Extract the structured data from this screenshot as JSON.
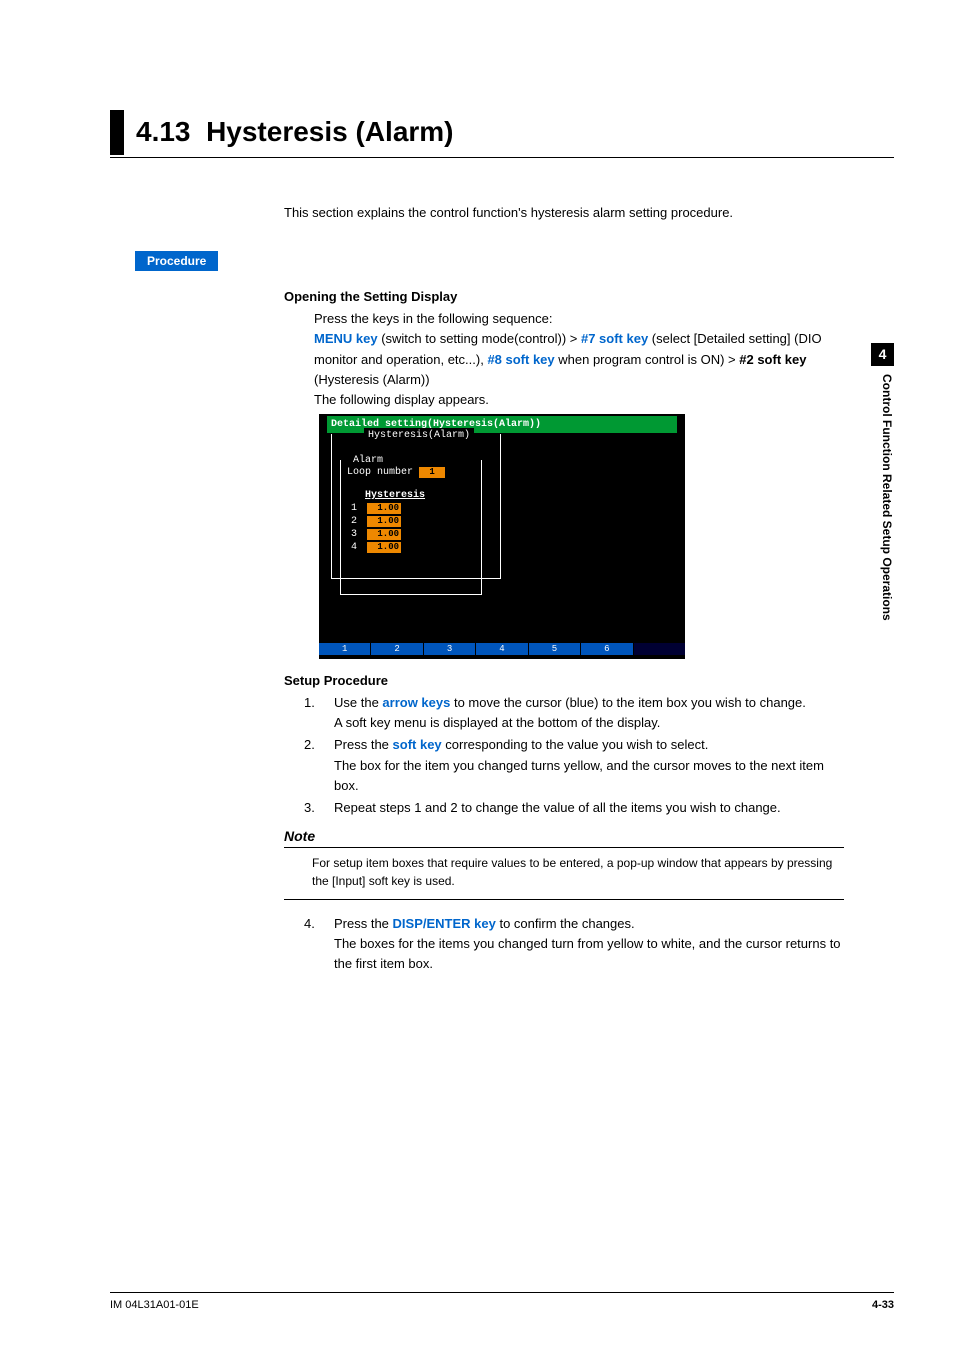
{
  "chapter_tab": "4",
  "side_text": "Control Function Related Setup Operations",
  "section_number": "4.13",
  "section_title": "Hysteresis (Alarm)",
  "intro": "This section explains the control function's hysteresis alarm setting procedure.",
  "procedure_label": "Procedure",
  "opening_head": "Opening the Setting Display",
  "opening_intro": "Press the keys in the following sequence:",
  "keys": {
    "menu": "MENU key",
    "menu_after": " (switch to setting mode(control)) > ",
    "sk7": "#7 soft key",
    "sk7_after": " (select [Detailed setting] (DIO monitor and operation, etc...), ",
    "sk8": "#8 soft key",
    "sk8_after": " when program control is ON) > ",
    "sk2": "#2 soft key",
    "sk2_after": " (Hysteresis (Alarm))"
  },
  "following_display": "The following display appears.",
  "figure": {
    "title": "Detailed setting(Hysteresis(Alarm))",
    "legend": "Hysteresis(Alarm)",
    "alarm_label": "Alarm",
    "loop_label": "Loop number",
    "loop_value": "1",
    "hyst_header": "Hysteresis",
    "rows": [
      {
        "n": "1",
        "v": "1.00"
      },
      {
        "n": "2",
        "v": "1.00"
      },
      {
        "n": "3",
        "v": "1.00"
      },
      {
        "n": "4",
        "v": "1.00"
      }
    ],
    "softkeys": [
      "1",
      "2",
      "3",
      "4",
      "5",
      "6",
      ""
    ]
  },
  "setup_head": "Setup Procedure",
  "steps": [
    {
      "n": "1.",
      "pre": "Use the ",
      "key": "arrow keys",
      "post": " to move the cursor (blue) to the item box you wish to change.",
      "extra": "A soft key menu is displayed at the bottom of the display."
    },
    {
      "n": "2.",
      "pre": "Press the ",
      "key": "soft key",
      "post": " corresponding to the value you wish to select.",
      "extra": "The box for the item you changed turns yellow, and the cursor moves to the next item box."
    },
    {
      "n": "3.",
      "pre": "Repeat steps 1 and 2 to change the value of all the items you wish to change.",
      "key": "",
      "post": "",
      "extra": ""
    }
  ],
  "note_label": "Note",
  "note_text": "For setup item boxes that require values to be entered, a pop-up window that appears by pressing the [Input] soft key is used.",
  "step4": {
    "n": "4.",
    "pre": "Press the ",
    "key": "DISP/ENTER key",
    "post": " to confirm the changes.",
    "extra": "The boxes for the items you changed turn from yellow to white, and the cursor returns to the first item box."
  },
  "footer_left": "IM 04L31A01-01E",
  "footer_right": "4-33"
}
